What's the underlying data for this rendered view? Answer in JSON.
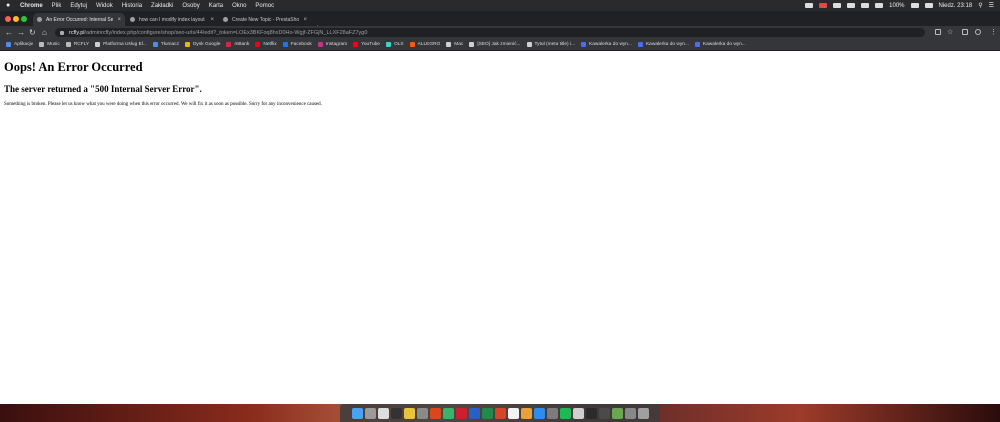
{
  "menubar": {
    "items": [
      "Chrome",
      "Plik",
      "Edytuj",
      "Widok",
      "Historia",
      "Zakładki",
      "Osoby",
      "Karta",
      "Okno",
      "Pomoc"
    ],
    "battery": "100%",
    "clock": "Niedz. 23:18"
  },
  "tabs": [
    {
      "title": "An Error Occurred: Internal Ser"
    },
    {
      "title": "how can I modify index layout"
    },
    {
      "title": "Create New Topic - PrestaShop"
    }
  ],
  "address": {
    "host": "rcfly.pl",
    "path": "/adminrcfly/index.php/configure/shop/seo-urls/44/edit?_token=LOEx3BKFoq8hxD0Ho-Wgjf-ZFGjN_LLXF28aFZ7yg0"
  },
  "bookmarks": [
    {
      "label": "Aplikacje",
      "color": "#4a8ef0"
    },
    {
      "label": "Music",
      "color": "#bbbbbb"
    },
    {
      "label": "RCFLY",
      "color": "#bbbbbb"
    },
    {
      "label": "Platforma Usług El...",
      "color": "#cfcfcf"
    },
    {
      "label": "Tłumacz",
      "color": "#4a8ef0"
    },
    {
      "label": "Dysk Google",
      "color": "#f4b400"
    },
    {
      "label": "mBank",
      "color": "#d7263d"
    },
    {
      "label": "Netflix",
      "color": "#e50914"
    },
    {
      "label": "Facebook",
      "color": "#1877f2"
    },
    {
      "label": "Instagram",
      "color": "#c13584"
    },
    {
      "label": "YouTube",
      "color": "#ff0000"
    },
    {
      "label": "OLX",
      "color": "#3ad4c6"
    },
    {
      "label": "ALLEGRO",
      "color": "#ff5a00"
    },
    {
      "label": "Mac",
      "color": "#cfcfcf"
    },
    {
      "label": "[SEO] Jak zmienić...",
      "color": "#cfcfcf"
    },
    {
      "label": "Tytuł (meta title) i...",
      "color": "#cfcfcf"
    },
    {
      "label": "Kawalerka do wyn...",
      "color": "#4a6cf7"
    },
    {
      "label": "Kawalerka do wyn...",
      "color": "#4a6cf7"
    },
    {
      "label": "Kawalerka do wyn...",
      "color": "#4a6cf7"
    }
  ],
  "page": {
    "heading": "Oops! An Error Occurred",
    "subheading": "The server returned a \"500 Internal Server Error\".",
    "message": "Something is broken. Please let us know what you were doing when this error occurred. We will fix it as soon as possible. Sorry for any inconvenience caused."
  },
  "dock": {
    "apps": [
      {
        "name": "finder-icon",
        "color": "#4aa3f0"
      },
      {
        "name": "launchpad-icon",
        "color": "#9a9a9a"
      },
      {
        "name": "safari-icon",
        "color": "#dddddd"
      },
      {
        "name": "activity-icon",
        "color": "#333333"
      },
      {
        "name": "chrome-icon",
        "color": "#e8c33b"
      },
      {
        "name": "system-icon",
        "color": "#8a8a8a"
      },
      {
        "name": "filezilla-icon",
        "color": "#d8481c"
      },
      {
        "name": "app-green-icon",
        "color": "#3bb36a"
      },
      {
        "name": "opera-icon",
        "color": "#cc1f2f"
      },
      {
        "name": "word-icon",
        "color": "#2b5fc8"
      },
      {
        "name": "excel-icon",
        "color": "#1f8a4c"
      },
      {
        "name": "powerpoint-icon",
        "color": "#d24726"
      },
      {
        "name": "calendar-icon",
        "color": "#f2f2f2"
      },
      {
        "name": "photos-icon",
        "color": "#e9a23b"
      },
      {
        "name": "app-store-icon",
        "color": "#2d8cf0"
      },
      {
        "name": "settings-icon",
        "color": "#7c7c7c"
      },
      {
        "name": "spotify-icon",
        "color": "#1db954"
      },
      {
        "name": "preview-icon",
        "color": "#cfcfcf"
      },
      {
        "name": "terminal-icon",
        "color": "#2b2b2b"
      },
      {
        "name": "editor-icon",
        "color": "#4a4a4a"
      },
      {
        "name": "photo-icon",
        "color": "#6aa84f"
      },
      {
        "name": "downloads-icon",
        "color": "#888888"
      },
      {
        "name": "trash-icon",
        "color": "#a0a0a0"
      }
    ]
  }
}
